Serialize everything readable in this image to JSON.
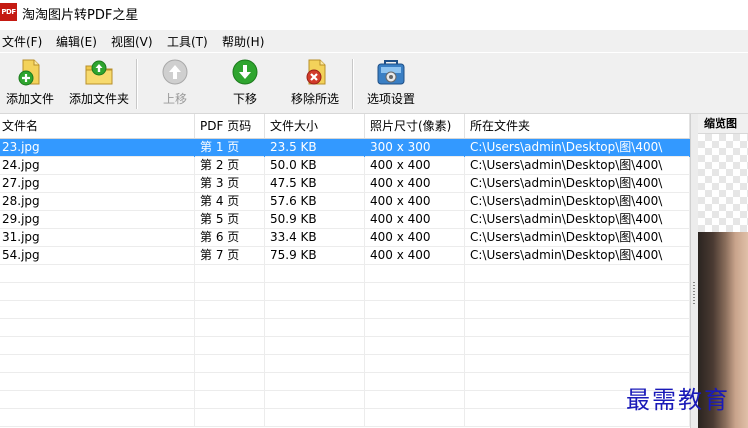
{
  "window": {
    "title": "淘淘图片转PDF之星",
    "icon_text": "PDF"
  },
  "menu": [
    {
      "label": "文件(F)"
    },
    {
      "label": "编辑(E)"
    },
    {
      "label": "视图(V)"
    },
    {
      "label": "工具(T)"
    },
    {
      "label": "帮助(H)"
    }
  ],
  "toolbar": {
    "add_file": "添加文件",
    "add_folder": "添加文件夹",
    "move_up": "上移",
    "move_down": "下移",
    "remove_selected": "移除所选",
    "options": "选项设置"
  },
  "table": {
    "columns": [
      "文件名",
      "PDF 页码",
      "文件大小",
      "照片尺寸(像素)",
      "所在文件夹"
    ],
    "rows": [
      [
        "23.jpg",
        "第 1 页",
        "23.5 KB",
        "300 x 300",
        "C:\\Users\\admin\\Desktop\\图\\400\\"
      ],
      [
        "24.jpg",
        "第 2 页",
        "50.0 KB",
        "400 x 400",
        "C:\\Users\\admin\\Desktop\\图\\400\\"
      ],
      [
        "27.jpg",
        "第 3 页",
        "47.5 KB",
        "400 x 400",
        "C:\\Users\\admin\\Desktop\\图\\400\\"
      ],
      [
        "28.jpg",
        "第 4 页",
        "57.6 KB",
        "400 x 400",
        "C:\\Users\\admin\\Desktop\\图\\400\\"
      ],
      [
        "29.jpg",
        "第 5 页",
        "50.9 KB",
        "400 x 400",
        "C:\\Users\\admin\\Desktop\\图\\400\\"
      ],
      [
        "31.jpg",
        "第 6 页",
        "33.4 KB",
        "400 x 400",
        "C:\\Users\\admin\\Desktop\\图\\400\\"
      ],
      [
        "54.jpg",
        "第 7 页",
        "75.9 KB",
        "400 x 400",
        "C:\\Users\\admin\\Desktop\\图\\400\\"
      ]
    ],
    "selected_row": 0
  },
  "preview": {
    "title": "缩览图"
  },
  "watermark": "最需教育",
  "colors": {
    "selection": "#3399ff",
    "accent_green": "#2fa52f",
    "accent_red": "#d23b2a"
  }
}
